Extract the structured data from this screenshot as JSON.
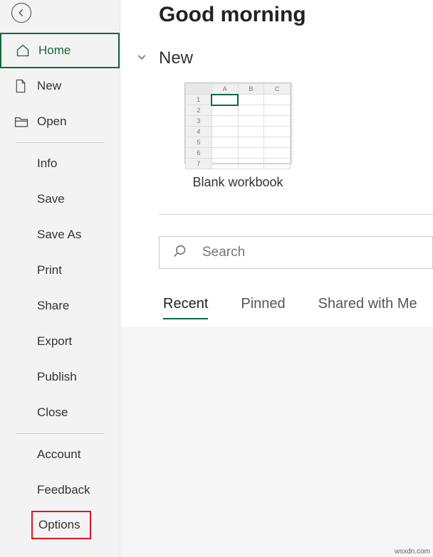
{
  "sidebar": {
    "primary": [
      {
        "label": "Home"
      },
      {
        "label": "New"
      },
      {
        "label": "Open"
      }
    ],
    "secondary": [
      {
        "label": "Info"
      },
      {
        "label": "Save"
      },
      {
        "label": "Save As"
      },
      {
        "label": "Print"
      },
      {
        "label": "Share"
      },
      {
        "label": "Export"
      },
      {
        "label": "Publish"
      },
      {
        "label": "Close"
      }
    ],
    "tertiary": [
      {
        "label": "Account"
      },
      {
        "label": "Feedback"
      },
      {
        "label": "Options"
      }
    ]
  },
  "main": {
    "greeting": "Good morning",
    "section_new": "New",
    "template_blank": "Blank workbook",
    "search_placeholder": "Search",
    "tabs": [
      {
        "label": "Recent"
      },
      {
        "label": "Pinned"
      },
      {
        "label": "Shared with Me"
      }
    ],
    "thumb_cols": [
      "A",
      "B",
      "C"
    ],
    "thumb_rows": [
      "1",
      "2",
      "3",
      "4",
      "5",
      "6",
      "7"
    ]
  },
  "watermark": "wsxdn.com"
}
